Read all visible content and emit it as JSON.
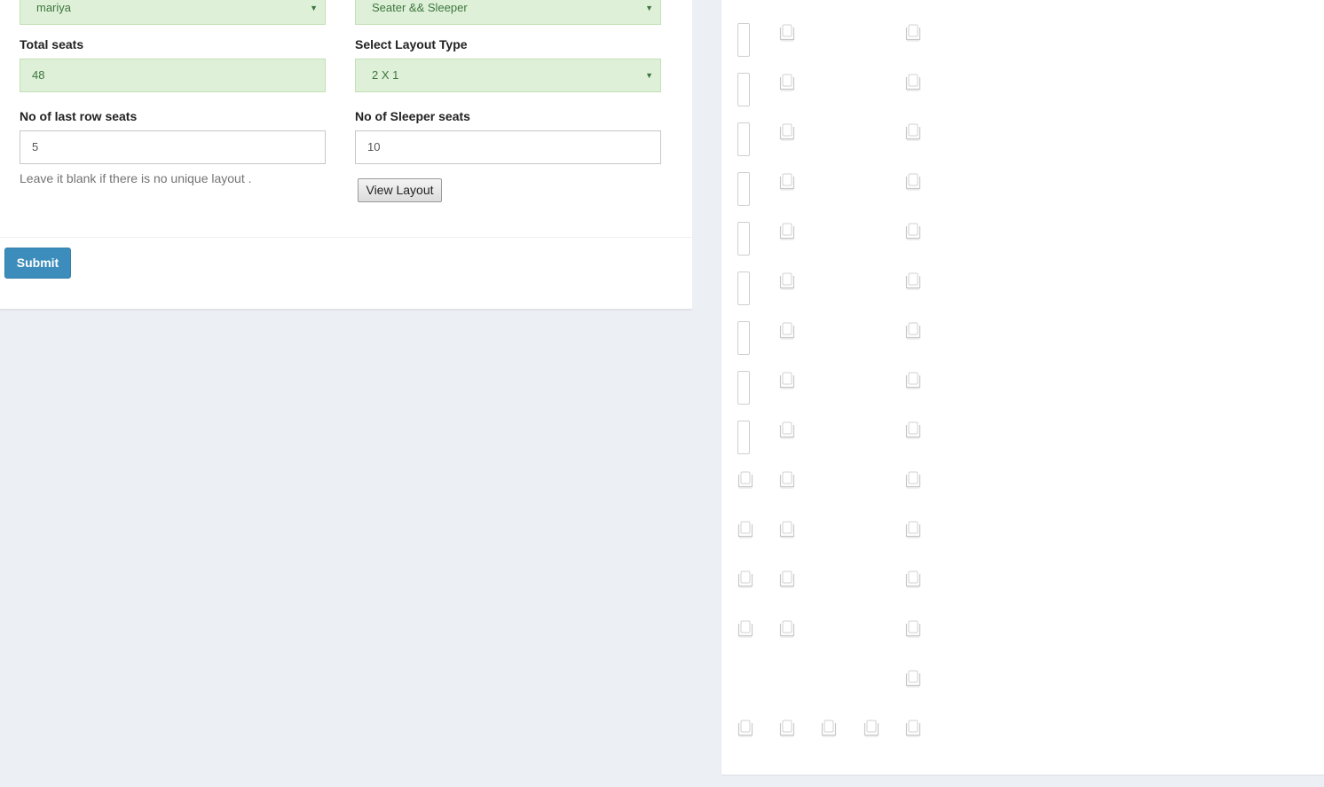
{
  "form": {
    "operator_select": {
      "value": "mariya"
    },
    "bus_type_select": {
      "value": "Seater && Sleeper"
    },
    "total_seats": {
      "label": "Total seats",
      "value": "48"
    },
    "layout_type": {
      "label": "Select Layout Type",
      "value": "2 X 1"
    },
    "last_row_seats": {
      "label": "No of last row seats",
      "value": "5",
      "help": "Leave it blank if there is no unique layout ."
    },
    "sleeper_seats": {
      "label": "No of Sleeper seats",
      "value": "10"
    },
    "view_layout_label": "View Layout",
    "submit_label": "Submit"
  },
  "seat_layout": {
    "rows": [
      [
        "sleeper",
        "seat",
        "",
        "",
        "seat"
      ],
      [
        "sleeper",
        "seat",
        "",
        "",
        "seat"
      ],
      [
        "sleeper",
        "seat",
        "",
        "",
        "seat"
      ],
      [
        "sleeper",
        "seat",
        "",
        "",
        "seat"
      ],
      [
        "sleeper",
        "seat",
        "",
        "",
        "seat"
      ],
      [
        "sleeper",
        "seat",
        "",
        "",
        "seat"
      ],
      [
        "sleeper",
        "seat",
        "",
        "",
        "seat"
      ],
      [
        "sleeper",
        "seat",
        "",
        "",
        "seat"
      ],
      [
        "sleeper",
        "seat",
        "",
        "",
        "seat"
      ],
      [
        "seat",
        "seat",
        "",
        "",
        "seat"
      ],
      [
        "seat",
        "seat",
        "",
        "",
        "seat"
      ],
      [
        "seat",
        "seat",
        "",
        "",
        "seat"
      ],
      [
        "seat",
        "seat",
        "",
        "",
        "seat"
      ],
      [
        "",
        "",
        "",
        "",
        "seat"
      ],
      [
        "seat",
        "seat",
        "seat",
        "seat",
        "seat"
      ]
    ]
  },
  "icons": {
    "seat": "seat-icon",
    "sleeper": "sleeper-berth-icon",
    "caret": "caret-down-icon"
  },
  "colors": {
    "success_bg": "#dff0d8",
    "success_text": "#3c763d",
    "primary": "#3c8dbc",
    "page_bg": "#ecf0f5"
  }
}
